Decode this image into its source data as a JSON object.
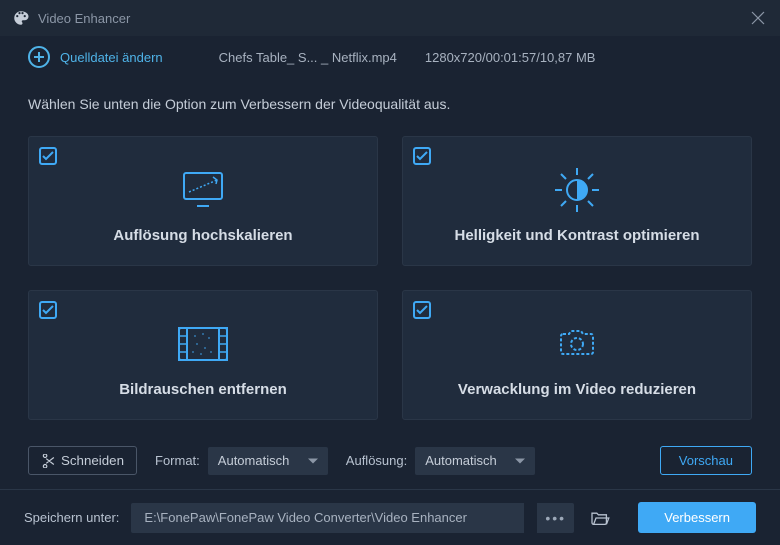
{
  "titlebar": {
    "title": "Video Enhancer"
  },
  "toolbar": {
    "change_source_label": "Quelldatei ändern",
    "filename": "Chefs Table_ S... _ Netflix.mp4",
    "metadata": "1280x720/00:01:57/10,87 MB"
  },
  "instruction": "Wählen Sie unten die Option zum Verbessern der Videoqualität aus.",
  "cards": {
    "upscale": {
      "label": "Auflösung hochskalieren"
    },
    "brightness": {
      "label": "Helligkeit und Kontrast optimieren"
    },
    "denoise": {
      "label": "Bildrauschen entfernen"
    },
    "deshake": {
      "label": "Verwacklung im Video reduzieren"
    }
  },
  "controls": {
    "cut_label": "Schneiden",
    "format_label": "Format:",
    "format_value": "Automatisch",
    "resolution_label": "Auflösung:",
    "resolution_value": "Automatisch",
    "preview_label": "Vorschau"
  },
  "bottombar": {
    "save_label": "Speichern unter:",
    "path": "E:\\FonePaw\\FonePaw Video Converter\\Video Enhancer",
    "enhance_label": "Verbessern"
  },
  "colors": {
    "accent": "#3fa9f5",
    "bg": "#1a2332",
    "card": "#202c3d"
  }
}
